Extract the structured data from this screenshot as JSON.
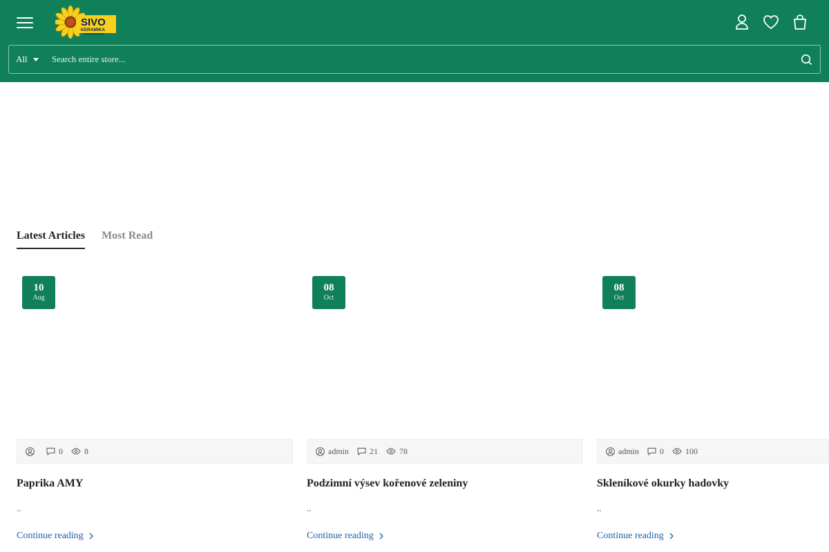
{
  "header": {
    "brand_colors": {
      "bar": "#10805a",
      "logo_yellow": "#f7d11a",
      "logo_text": "#101e4d"
    },
    "logo": {
      "name": "SIVO",
      "subtitle": "KERAMIKA"
    }
  },
  "search": {
    "category": "All",
    "placeholder": "Search entire store..."
  },
  "tabs": [
    {
      "label": "Latest Articles",
      "active": true
    },
    {
      "label": "Most Read",
      "active": false
    }
  ],
  "articles": [
    {
      "day": "10",
      "month": "Aug",
      "author": "",
      "comments": "0",
      "views": "8",
      "title": "Paprika AMY",
      "excerpt": "..",
      "more": "Continue reading"
    },
    {
      "day": "08",
      "month": "Oct",
      "author": "admin",
      "comments": "21",
      "views": "78",
      "title": "Podzimní výsev kořenové zeleniny",
      "excerpt": "..",
      "more": "Continue reading"
    },
    {
      "day": "08",
      "month": "Oct",
      "author": "admin",
      "comments": "0",
      "views": "100",
      "title": "Skleníkové okurky hadovky",
      "excerpt": "..",
      "more": "Continue reading"
    }
  ]
}
